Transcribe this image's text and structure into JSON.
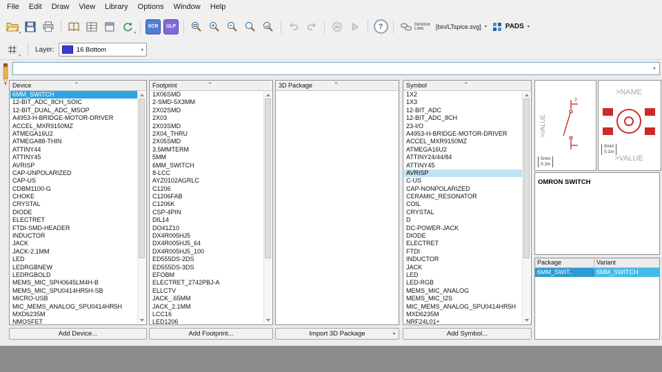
{
  "menu": {
    "items": [
      "File",
      "Edit",
      "Draw",
      "View",
      "Library",
      "Options",
      "Window",
      "Help"
    ]
  },
  "toolbar": {
    "scr": "SCR",
    "ulp": "ULP",
    "help": "?",
    "design_link_line1": "DESIGN",
    "design_link_line2": "LINK",
    "ltspice": "[bin/LTspice.svg]",
    "pads": "PADS"
  },
  "layerbar": {
    "label": "Layer:",
    "selected": "16 Bottom",
    "swatch_color": "#3b3bd8"
  },
  "command": {
    "value": ""
  },
  "icons": {
    "sort_asc": "^",
    "dropdown": "▾"
  },
  "panels": {
    "device": {
      "title": "Device",
      "button": "Add Device...",
      "selected_index": 0,
      "selected_style": "active",
      "items": [
        "6MM_SWITCH",
        "12-BIT_ADC_8CH_SOIC",
        "12-BIT_DUAL_ADC_MSOP",
        "A4953-H-BRIDGE-MOTOR-DRIVER",
        "ACCEL_MXR9150MZ",
        "ATMEGA16U2",
        "ATMEGA88-THIN",
        "ATTINY44",
        "ATTINY45",
        "AVRISP",
        "CAP-UNPOLARIZED",
        "CAP-US",
        "CDBM1100-G",
        "CHOKE",
        "CRYSTAL",
        "DIODE",
        "ELECTRET",
        "FTDI-SMD-HEADER",
        "INDUCTOR",
        "JACK",
        "JACK-2.1MM",
        "LED",
        "LEDRGBNEW",
        "LEDRGBOLD",
        "MEMS_MIC_SPH0645LM4H-B",
        "MEMS_MIC_SPU0414HR5H-SB",
        "MICRO-USB",
        "MIC_MEMS_ANALOG_SPU0414HR5H",
        "MXD6235M",
        "NMOSFET"
      ]
    },
    "footprint": {
      "title": "Footprint",
      "button": "Add Footprint...",
      "selected_index": -1,
      "items": [
        "1X06SMD",
        "2-SMD-5X3MM",
        "2X02SMD",
        "2X03",
        "2X03SMD",
        "2X04_THRU",
        "2X05SMD",
        "3.5MMTERM",
        "5MM",
        "6MM_SWITCH",
        "8-LCC",
        "AYZ0102AGRLC",
        "C1206",
        "C1206FAB",
        "C1206K",
        "CSP-4PIN",
        "DIL14",
        "DO41Z10",
        "DX4R005HJ5",
        "DX4R005HJ5_64",
        "DX4R005HJ5_100",
        "ED555DS-2DS",
        "ED555DS-3DS",
        "EFOBM",
        "ELECTRET_2742PBJ-A",
        "ELLCTV",
        "JACK_.65MM",
        "JACK_2.1MM",
        "LCC16",
        "LED1206"
      ]
    },
    "package3d": {
      "title": "3D Package",
      "button": "Import 3D Package",
      "selected_index": -1,
      "items": []
    },
    "symbol": {
      "title": "Symbol",
      "button": "Add Symbol...",
      "selected_index": 10,
      "selected_style": "inactive",
      "items": [
        "1X2",
        "1X3",
        "12-BIT_ADC",
        "12-BIT_ADC_8CH",
        "23-I/O",
        "A4953-H-BRIDGE-MOTOR-DRIVER",
        "ACCEL_MXR9150MZ",
        "ATMEGA16U2",
        "ATTINY24/44/84",
        "ATTINY45",
        "AVRISP",
        "C-US",
        "CAP-NONPOLARIZED",
        "CERAMIC_RESONATOR",
        "COIL",
        "CRYSTAL",
        "D",
        "DC-POWER-JACK",
        "DIODE",
        "ELECTRET",
        "FTDI",
        "INDUCTOR",
        "JACK",
        "LED",
        "LED-RGB",
        "MEMS_MIC_ANALOG",
        "MEMS_MIC_I2S",
        "MIC_MEMS_ANALOG_SPU0414HR5H",
        "MXD6235M",
        "NRF24L01+"
      ]
    }
  },
  "preview": {
    "symbol_value_label": ">VALUE",
    "symbol_pin": "2",
    "symbol_scale_mm": "5mm",
    "symbol_scale_in": "0.2in",
    "package_name_label": ">NAME",
    "package_value_label": ">VALUE",
    "package_scale_mm": "5mm",
    "package_scale_in": "0.1in",
    "description": "OMRON SWITCH",
    "table": {
      "headers": [
        "Package",
        "Variant"
      ],
      "row": [
        "6MM_SWIT..",
        "6MM_SWITCH"
      ]
    }
  },
  "colors": {
    "selection_active": "#2fa3e0",
    "selection_inactive": "#c2e3f5",
    "symbol_red": "#c22222",
    "layer_bottom_blue": "#3b3bd8"
  }
}
